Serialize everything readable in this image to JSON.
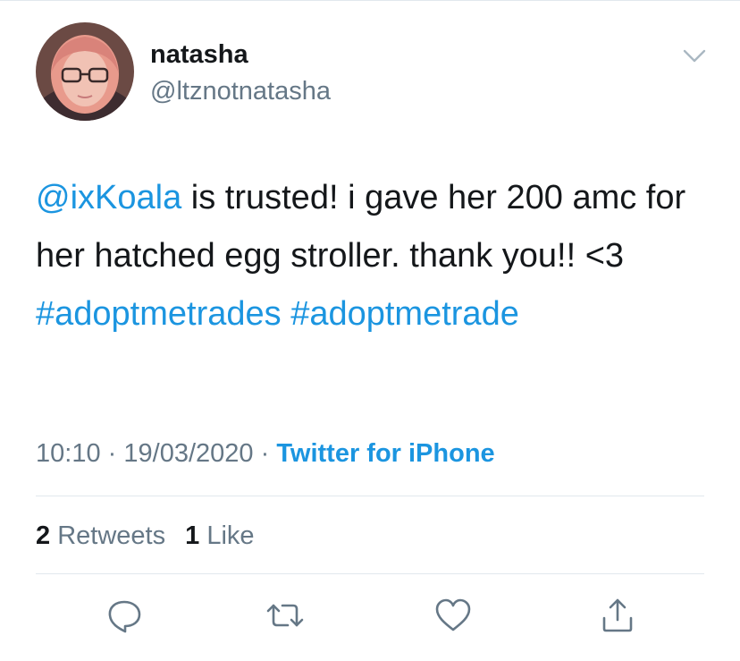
{
  "user": {
    "display_name": "natasha",
    "handle": "@ltznotnatasha"
  },
  "tweet": {
    "segments": [
      {
        "text": "@ixKoala",
        "type": "mention"
      },
      {
        "text": " is trusted! i gave her 200 amc for her hatched egg stroller. thank you!! <3 ",
        "type": "text"
      },
      {
        "text": "#adoptmetrades",
        "type": "hashtag"
      },
      {
        "text": " ",
        "type": "text"
      },
      {
        "text": "#adoptmetrade",
        "type": "hashtag"
      }
    ],
    "time": "10:10",
    "separator": "·",
    "date": "19/03/2020",
    "source": "Twitter for iPhone"
  },
  "stats": {
    "retweets_count": "2",
    "retweets_label": "Retweets",
    "likes_count": "1",
    "likes_label": "Like"
  },
  "icons": {
    "caret": "chevron-down-icon",
    "reply": "reply-icon",
    "retweet": "retweet-icon",
    "like": "heart-icon",
    "share": "share-icon"
  },
  "colors": {
    "link": "#1b95e0",
    "secondary_text": "#657786",
    "primary_text": "#14171a",
    "divider": "#e1e8ed"
  }
}
